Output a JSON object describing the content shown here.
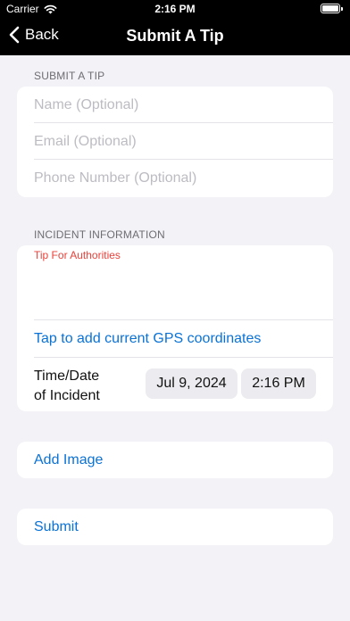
{
  "status_bar": {
    "carrier": "Carrier",
    "time": "2:16 PM",
    "battery_level": 1.0
  },
  "nav": {
    "back_label": "Back",
    "title": "Submit A Tip"
  },
  "tip_section": {
    "header": "SUBMIT A TIP",
    "name_placeholder": "Name (Optional)",
    "email_placeholder": "Email (Optional)",
    "phone_placeholder": "Phone Number (Optional)"
  },
  "incident_section": {
    "header": "INCIDENT INFORMATION",
    "tip_placeholder": "Tip For Authorities",
    "gps_link": "Tap to add current GPS coordinates",
    "datetime_label_line1": "Time/Date",
    "datetime_label_line2": "of Incident",
    "date_value": "Jul 9, 2024",
    "time_value": "2:16 PM"
  },
  "actions": {
    "add_image": "Add Image",
    "submit": "Submit"
  },
  "colors": {
    "accent": "#0a72d6",
    "tip_placeholder": "#e9423a",
    "background": "#f2f2f7"
  }
}
